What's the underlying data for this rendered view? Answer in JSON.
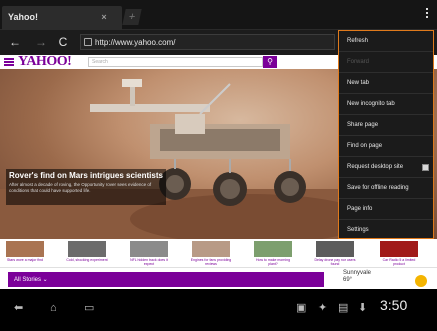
{
  "browser": {
    "tab": {
      "title": "Yahoo!",
      "close": "×"
    },
    "new_tab_glyph": "+",
    "url": "http://www.yahoo.com/",
    "icons": [
      "back-icon",
      "forward-icon",
      "reload-icon",
      "globe-icon",
      "overflow-menu-icon"
    ]
  },
  "yahoo": {
    "logo": "YAHOO!",
    "search_placeholder": "Search",
    "hero": {
      "headline": "Rover's find on Mars intrigues scientists",
      "body": "After almost a decade of roving, the Opportunity rover sees evidence of conditions that could have supported life."
    },
    "thumbs": [
      "Stars wore a major find",
      "Cold, shocking experiment",
      "NFL hidden track does it expect",
      "Engines for fans providing reviews",
      "How to make morning plant?",
      "Delay drone pay nor users found",
      "Car Radio 5 a limited product"
    ],
    "stories_label": "All Stories ⌄",
    "weather": {
      "city": "Sunnyvale",
      "temp": "69°"
    }
  },
  "menu": {
    "items": [
      {
        "label": "Refresh",
        "enabled": true
      },
      {
        "label": "Forward",
        "enabled": false
      },
      {
        "label": "New tab",
        "enabled": true
      },
      {
        "label": "New incognito tab",
        "enabled": true
      },
      {
        "label": "Share page",
        "enabled": true
      },
      {
        "label": "Find on page",
        "enabled": true
      },
      {
        "label": "Request desktop site",
        "enabled": true,
        "checkbox": true
      },
      {
        "label": "Save for offline reading",
        "enabled": true
      },
      {
        "label": "Page info",
        "enabled": true
      },
      {
        "label": "Settings",
        "enabled": true
      }
    ]
  },
  "system": {
    "clock": "3:50",
    "icons": [
      "back-icon",
      "home-icon",
      "recent-apps-icon",
      "screenshot-icon",
      "usb-icon",
      "gallery-icon",
      "download-icon"
    ]
  },
  "colors": {
    "accent": "#7b0099",
    "menu_border": "#e07a1c",
    "menu_bg": "#1b1b1b"
  }
}
